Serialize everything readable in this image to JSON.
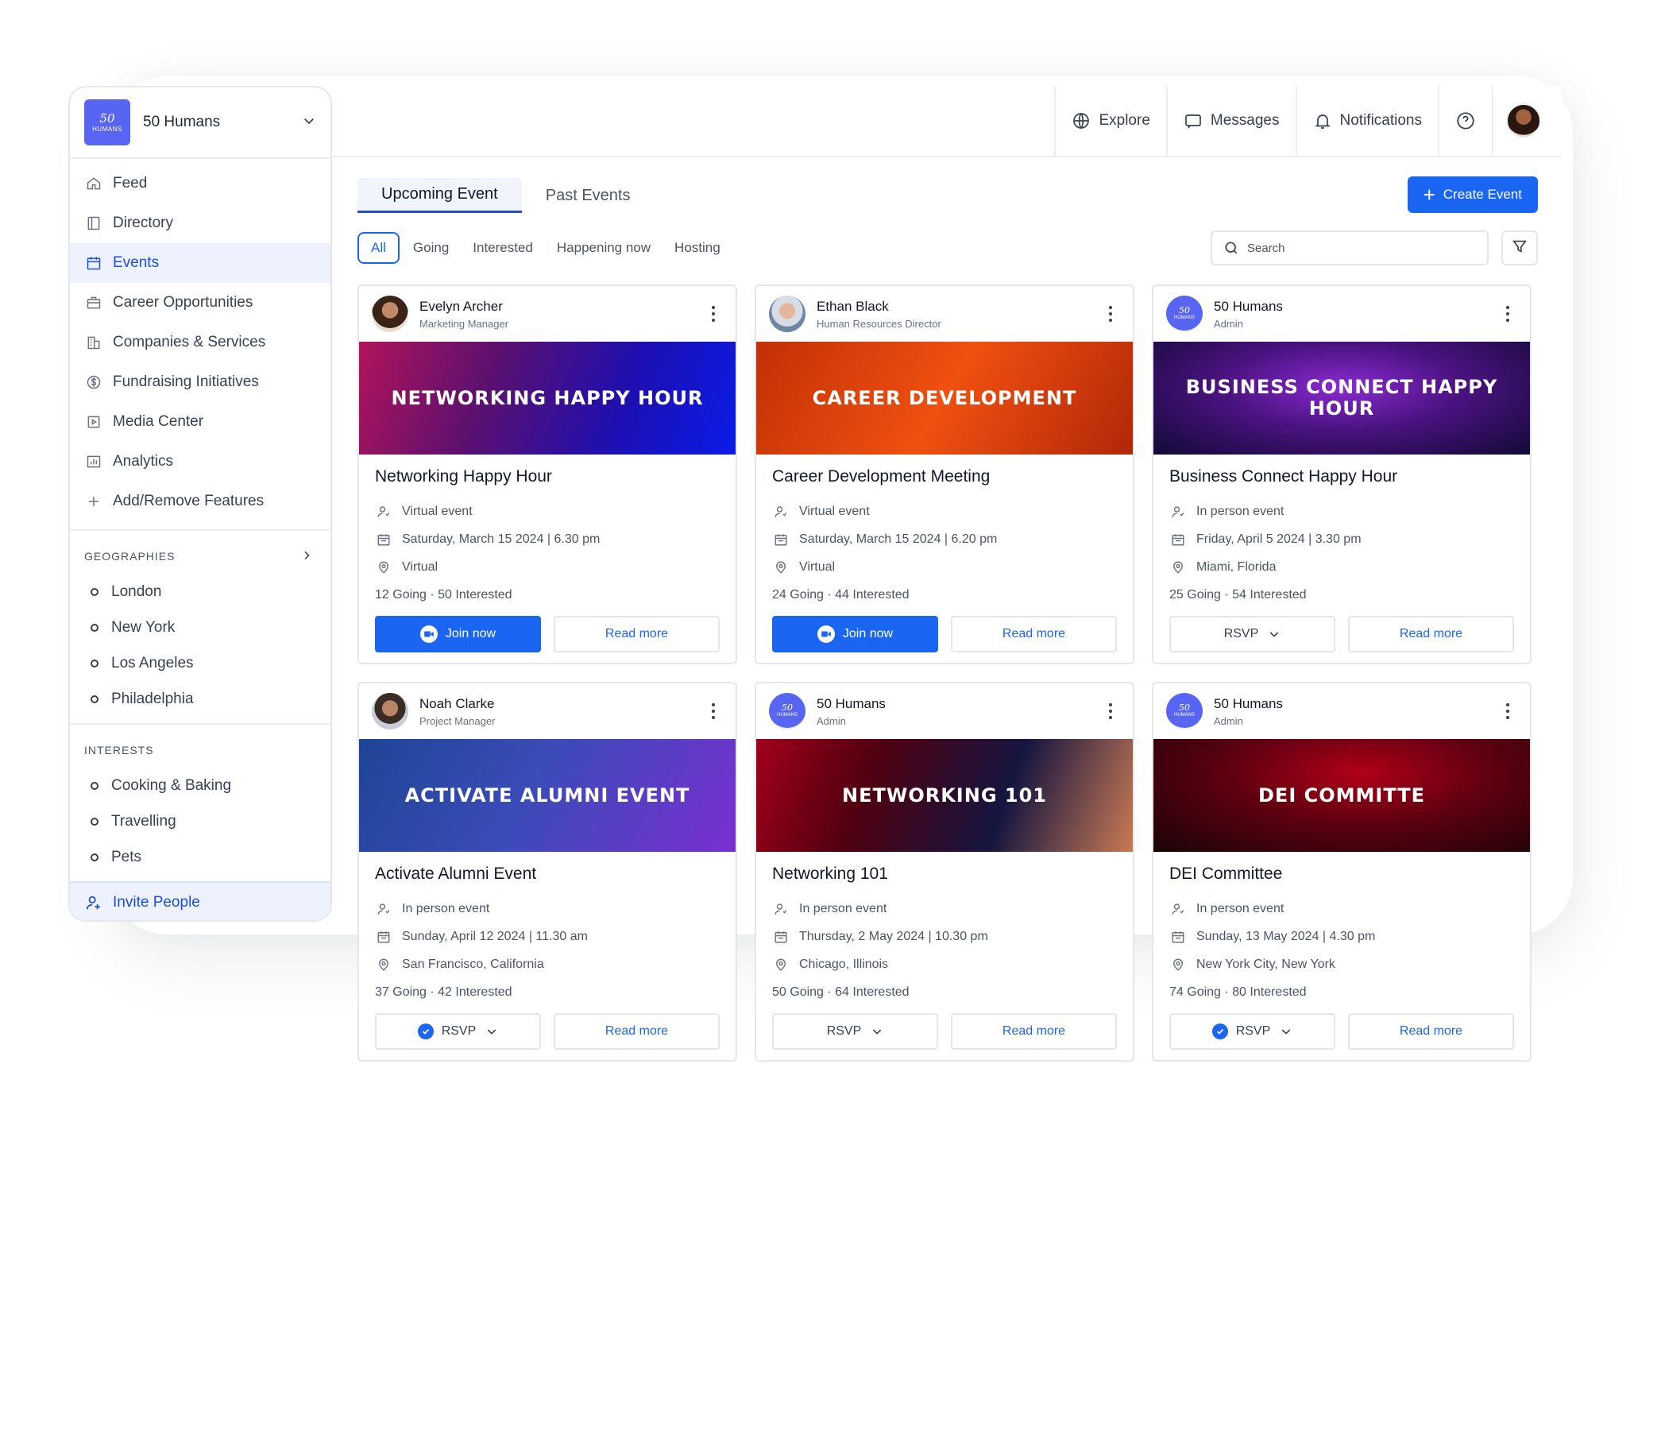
{
  "org": {
    "logo_num": "50",
    "logo_text": "HUMANS",
    "name": "50 Humans"
  },
  "nav": [
    {
      "label": "Feed"
    },
    {
      "label": "Directory"
    },
    {
      "label": "Events",
      "active": true
    },
    {
      "label": "Career Opportunities"
    },
    {
      "label": "Companies & Services"
    },
    {
      "label": "Fundraising Initiatives"
    },
    {
      "label": "Media Center"
    },
    {
      "label": "Analytics"
    },
    {
      "label": "Add/Remove Features"
    }
  ],
  "geographies": {
    "title": "GEOGRAPHIES",
    "items": [
      "London",
      "New York",
      "Los Angeles",
      "Philadelphia"
    ]
  },
  "interests": {
    "title": "INTERESTS",
    "items": [
      "Cooking & Baking",
      "Travelling",
      "Pets"
    ]
  },
  "invite_label": "Invite People",
  "topbar": {
    "explore": "Explore",
    "messages": "Messages",
    "notifications": "Notifications"
  },
  "tabs": {
    "upcoming": "Upcoming Event",
    "past": "Past Events"
  },
  "create_event": "Create Event",
  "filters": [
    "All",
    "Going",
    "Interested",
    "Happening now",
    "Hosting"
  ],
  "search": {
    "placeholder": "Search"
  },
  "events": [
    {
      "host_name": "Evelyn Archer",
      "host_role": "Marketing Manager",
      "banner": "NETWORKING HAPPY HOUR",
      "title": "Networking Happy Hour",
      "type": "Virtual event",
      "date": "Saturday, March 15 2024 | 6.30 pm",
      "location": "Virtual",
      "counts": "12 Going · 50 Interested",
      "primary": "Join now",
      "secondary": "Read more"
    },
    {
      "host_name": "Ethan Black",
      "host_role": "Human Resources Director",
      "banner": "CAREER DEVELOPMENT",
      "title": "Career Development Meeting",
      "type": "Virtual event",
      "date": "Saturday, March 15 2024 | 6.20 pm",
      "location": "Virtual",
      "counts": "24 Going · 44 Interested",
      "primary": "Join now",
      "secondary": "Read more"
    },
    {
      "host_name": "50 Humans",
      "host_role": "Admin",
      "banner": "BUSINESS CONNECT HAPPY HOUR",
      "title": "Business Connect Happy Hour",
      "type": "In person event",
      "date": "Friday, April 5 2024 | 3.30 pm",
      "location": "Miami, Florida",
      "counts": "25 Going · 54 Interested",
      "primary": "RSVP",
      "secondary": "Read more"
    },
    {
      "host_name": "Noah Clarke",
      "host_role": "Project Manager",
      "banner": "ACTIVATE ALUMNI EVENT",
      "title": "Activate Alumni Event",
      "type": "In person event",
      "date": "Sunday, April 12 2024 | 11.30 am",
      "location": "San Francisco, California",
      "counts": "37 Going · 42 Interested",
      "primary": "RSVP",
      "secondary": "Read more"
    },
    {
      "host_name": "50 Humans",
      "host_role": "Admin",
      "banner": "NETWORKING 101",
      "title": "Networking 101",
      "type": "In person event",
      "date": "Thursday, 2 May 2024 | 10.30 pm",
      "location": "Chicago, Illinois",
      "counts": "50 Going · 64 Interested",
      "primary": "RSVP",
      "secondary": "Read more"
    },
    {
      "host_name": "50 Humans",
      "host_role": "Admin",
      "banner": "DEI COMMITTE",
      "title": "DEI Committee",
      "type": "In person event",
      "date": "Sunday, 13 May 2024 | 4.30 pm",
      "location": "New York City, New York",
      "counts": "74 Going · 80 Interested",
      "primary": "RSVP",
      "secondary": "Read more"
    }
  ],
  "colors": {
    "accent": "#1a66f2",
    "active_bg": "#eef2ff",
    "brand_logo": "#5865f2"
  }
}
